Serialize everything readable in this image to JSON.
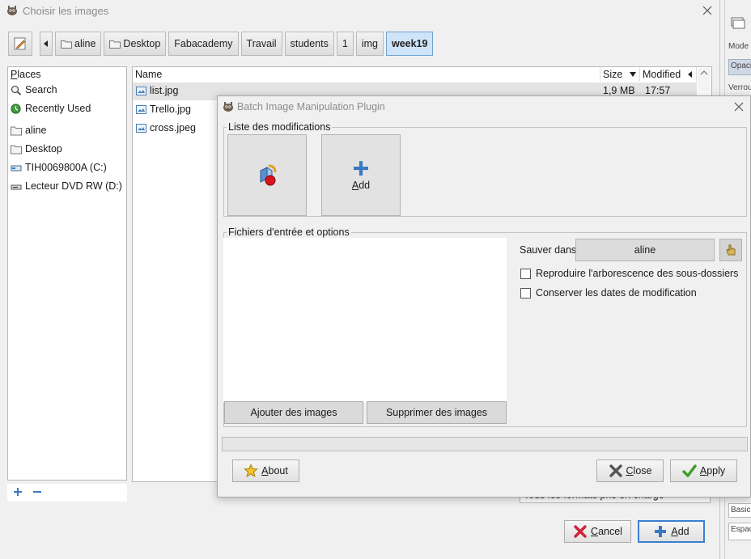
{
  "colors": {
    "accent": "#3c7fd1",
    "active_path": "#cfe4f8",
    "window_bg": "#f0f0f0"
  },
  "chooser": {
    "title": "Choisir les images",
    "path": [
      "aline",
      "Desktop",
      "Fabacademy",
      "Travail",
      "students",
      "1",
      "img",
      "week19"
    ],
    "places_label": "Places",
    "places_label_rest": "laces",
    "places_label_mnemonic": "P",
    "places": [
      {
        "label": "Search",
        "icon": "search-icon"
      },
      {
        "label": "Recently Used",
        "icon": "recent-icon"
      },
      {
        "label": "aline",
        "icon": "folder-icon"
      },
      {
        "label": "Desktop",
        "icon": "folder-icon"
      },
      {
        "label": "TIH0069800A (C:)",
        "icon": "drive-icon"
      },
      {
        "label": "Lecteur DVD RW (D:)",
        "icon": "dvd-icon"
      }
    ],
    "columns": {
      "name": "Name",
      "size": "Size",
      "modified": "Modified"
    },
    "files": [
      {
        "name": "list.jpg",
        "size": "1,9 MB",
        "modified": "17:57"
      },
      {
        "name": "Trello.jpg",
        "size": "",
        "modified": ""
      },
      {
        "name": "cross.jpeg",
        "size": "",
        "modified": ""
      }
    ],
    "filter_value": "Tous les formats pris en charge",
    "cancel_label": "Cancel",
    "cancel_rest": "ancel",
    "cancel_mnemonic": "C",
    "add_label": "Add",
    "add_rest": "dd",
    "add_mnemonic": "A"
  },
  "side_panel": {
    "mode": "Mode",
    "opacity": "Opaci",
    "lock": "Verrou",
    "basic": "Basic.",
    "space": "Espace"
  },
  "bimp": {
    "title": "Batch Image Manipulation Plugin",
    "modifications_label": "Liste des modifications",
    "add_tile_label": "Add",
    "add_tile_rest": "dd",
    "add_tile_mnemonic": "A",
    "input_label": "Fichiers d'entrée et options",
    "save_in_label": "Sauver dans",
    "save_in_value": "aline",
    "check_tree": "Reproduire l'arborescence des sous-dossiers",
    "check_dates": "Conserver les dates de modification",
    "add_images": "Ajouter des images",
    "remove_images": "Supprimer des images",
    "about": "About",
    "about_rest": "bout",
    "about_mnemonic": "A",
    "close": "Close",
    "close_rest": "lose",
    "close_mnemonic": "C",
    "apply": "Apply",
    "apply_rest": "pply",
    "apply_mnemonic": "A",
    "progress": 0
  }
}
